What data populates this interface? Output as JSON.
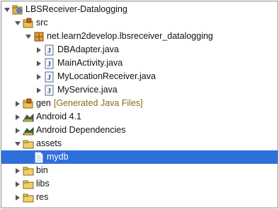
{
  "tree": {
    "project": {
      "label": "LBSReceiver-Datalogging",
      "icon": "android-project-icon",
      "expanded": true
    },
    "src": {
      "label": "src",
      "icon": "source-folder-icon",
      "expanded": true
    },
    "package": {
      "label": "net.learn2develop.lbsreceiver_datalogging",
      "icon": "package-icon",
      "expanded": true
    },
    "files": [
      {
        "label": "DBAdapter.java",
        "icon": "java-file-icon",
        "expanded": false
      },
      {
        "label": "MainActivity.java",
        "icon": "java-file-icon",
        "expanded": false
      },
      {
        "label": "MyLocationReceiver.java",
        "icon": "java-file-icon",
        "expanded": false
      },
      {
        "label": "MyService.java",
        "icon": "java-file-icon",
        "expanded": false
      }
    ],
    "gen": {
      "label": "gen",
      "decoration": "[Generated Java Files]",
      "icon": "source-folder-icon",
      "expanded": false
    },
    "android41": {
      "label": "Android 4.1",
      "icon": "library-icon",
      "expanded": false
    },
    "androidDeps": {
      "label": "Android Dependencies",
      "icon": "library-icon",
      "expanded": false
    },
    "assets": {
      "label": "assets",
      "icon": "folder-icon",
      "expanded": true
    },
    "mydb": {
      "label": "mydb",
      "icon": "file-icon",
      "selected": true
    },
    "bin": {
      "label": "bin",
      "icon": "folder-icon",
      "expanded": false
    },
    "libs": {
      "label": "libs",
      "icon": "folder-icon",
      "expanded": false
    },
    "res": {
      "label": "res",
      "icon": "folder-icon",
      "expanded": false
    }
  },
  "colors": {
    "selection": "#2f6fdb",
    "decoration": "#8a6a1a",
    "border": "#8c8c8c"
  }
}
